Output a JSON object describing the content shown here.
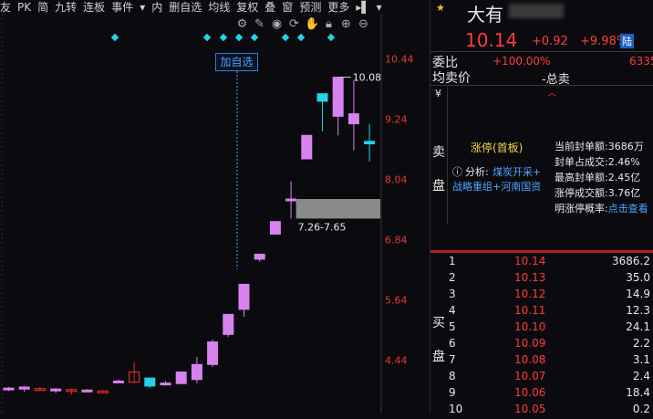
{
  "toolbar": {
    "items": [
      "友",
      "PK",
      "简",
      "九转",
      "连板",
      "事件",
      "▾",
      "内",
      "删自选",
      "均线",
      "复权",
      "叠",
      "窗",
      "预测",
      "更多",
      "▸▌",
      "▾"
    ]
  },
  "chart": {
    "y_ticks": [
      "10.44",
      "9.24",
      "8.04",
      "6.84",
      "5.64",
      "4.44"
    ],
    "high_label": "10.08",
    "add_watch_label": "加自选",
    "range_label": "7.26-7.65"
  },
  "chart_data": {
    "type": "candlestick",
    "ylim": [
      3.7,
      11.2
    ],
    "candles": [
      {
        "o": 3.85,
        "h": 3.9,
        "l": 3.82,
        "c": 3.88
      },
      {
        "o": 3.86,
        "h": 3.92,
        "l": 3.8,
        "c": 3.9
      },
      {
        "o": 3.87,
        "h": 3.9,
        "l": 3.82,
        "c": 3.85
      },
      {
        "o": 3.84,
        "h": 3.88,
        "l": 3.78,
        "c": 3.86
      },
      {
        "o": 3.85,
        "h": 3.87,
        "l": 3.75,
        "c": 3.82
      },
      {
        "o": 3.83,
        "h": 3.86,
        "l": 3.8,
        "c": 3.84
      },
      {
        "o": 3.82,
        "h": 3.84,
        "l": 3.79,
        "c": 3.81
      },
      {
        "o": 4.0,
        "h": 4.05,
        "l": 3.98,
        "c": 4.02
      },
      {
        "o": 4.2,
        "h": 4.4,
        "l": 3.98,
        "c": 4.0
      },
      {
        "o": 3.92,
        "h": 4.06,
        "l": 3.88,
        "c": 4.08
      },
      {
        "o": 3.95,
        "h": 4.02,
        "l": 3.93,
        "c": 3.98
      },
      {
        "o": 3.97,
        "h": 4.21,
        "l": 3.95,
        "c": 4.2
      },
      {
        "o": 4.05,
        "h": 4.5,
        "l": 3.98,
        "c": 4.35
      },
      {
        "o": 4.35,
        "h": 4.85,
        "l": 4.3,
        "c": 4.8
      },
      {
        "o": 4.95,
        "h": 5.35,
        "l": 4.9,
        "c": 5.35
      },
      {
        "o": 5.45,
        "h": 5.95,
        "l": 5.3,
        "c": 5.95
      },
      {
        "o": 6.45,
        "h": 6.55,
        "l": 6.4,
        "c": 6.55
      },
      {
        "o": 6.95,
        "h": 7.2,
        "l": 6.95,
        "c": 7.2
      },
      {
        "o": 7.65,
        "h": 8.0,
        "l": 7.26,
        "c": 7.65
      },
      {
        "o": 8.45,
        "h": 8.92,
        "l": 8.45,
        "c": 8.92
      },
      {
        "o": 9.6,
        "h": 9.75,
        "l": 9.0,
        "c": 9.75
      },
      {
        "o": 9.3,
        "h": 10.08,
        "l": 8.92,
        "c": 10.08
      },
      {
        "o": 9.15,
        "h": 10.0,
        "l": 8.62,
        "c": 9.35
      },
      {
        "o": 8.75,
        "h": 9.15,
        "l": 8.4,
        "c": 8.8
      }
    ]
  },
  "header": {
    "stock_name": "大有",
    "price": "10.14",
    "change": "+0.92",
    "change_pct": "+9.98%",
    "badge": "陆"
  },
  "quote": {
    "weibi_label": "委比",
    "weibi_value": "+100.00%",
    "weibi_extra": "6335",
    "jun_label": "均卖价",
    "total_sell_label": "-总卖",
    "yen": "¥"
  },
  "info": {
    "sell_side": [
      "卖",
      "盘"
    ],
    "limit_label": "涨停(首板)",
    "analysis_label": "分析:",
    "analysis_text1": "煤炭开采+",
    "analysis_text2": "战略重组+河南国资",
    "stats": [
      {
        "label": "当前封单额:",
        "value": "3686万"
      },
      {
        "label": "封单占成交:",
        "value": "2.46%"
      },
      {
        "label": "最高封单额:",
        "value": "2.45亿"
      },
      {
        "label": "涨停成交额:",
        "value": "3.76亿"
      },
      {
        "label": "明涨停概率:",
        "value": "点击查看"
      }
    ]
  },
  "bids": {
    "side": [
      "买",
      "盘"
    ],
    "rows": [
      {
        "idx": "1",
        "price": "10.14",
        "vol": "3686.2"
      },
      {
        "idx": "2",
        "price": "10.13",
        "vol": "35.0"
      },
      {
        "idx": "3",
        "price": "10.12",
        "vol": "14.9"
      },
      {
        "idx": "4",
        "price": "10.11",
        "vol": "12.3"
      },
      {
        "idx": "5",
        "price": "10.10",
        "vol": "24.1"
      },
      {
        "idx": "6",
        "price": "10.09",
        "vol": "2.2"
      },
      {
        "idx": "7",
        "price": "10.08",
        "vol": "3.1"
      },
      {
        "idx": "8",
        "price": "10.07",
        "vol": "2.4"
      },
      {
        "idx": "9",
        "price": "10.06",
        "vol": "18.4"
      },
      {
        "idx": "10",
        "price": "10.05",
        "vol": "0.2"
      }
    ]
  },
  "colors": {
    "up_body": "#d882f0",
    "down_edge": "#e02b2b",
    "cyan": "#22d4e6",
    "axis_red": "#e03a3a"
  }
}
